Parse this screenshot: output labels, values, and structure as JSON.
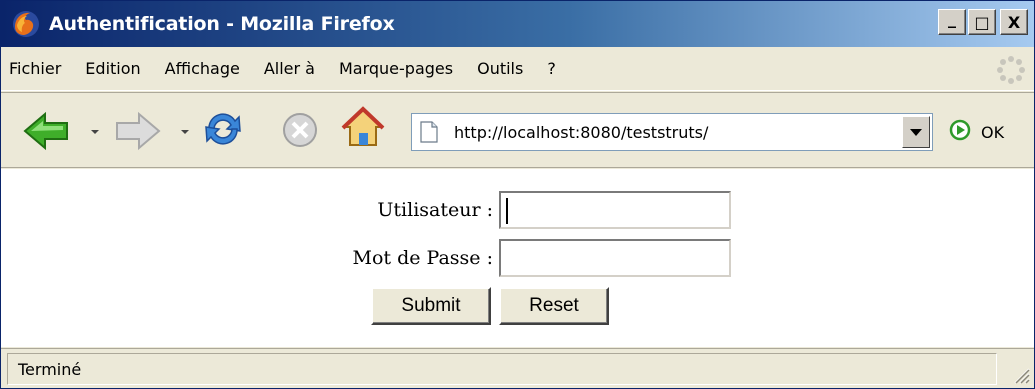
{
  "window": {
    "title": "Authentification - Mozilla Firefox",
    "minimize": "_",
    "maximize": "□",
    "close": "X"
  },
  "menu": {
    "items": [
      "Fichier",
      "Edition",
      "Affichage",
      "Aller à",
      "Marque-pages",
      "Outils",
      "?"
    ]
  },
  "toolbar": {
    "url": "http://localhost:8080/teststruts/",
    "go_label": "OK",
    "icons": [
      "back-icon",
      "forward-icon",
      "reload-icon",
      "stop-icon",
      "home-icon"
    ]
  },
  "form": {
    "user_label": "Utilisateur :",
    "user_value": "",
    "password_label": "Mot de Passe :",
    "password_value": "",
    "submit_label": "Submit",
    "reset_label": "Reset"
  },
  "status": {
    "text": "Terminé"
  },
  "colors": {
    "title_start": "#0a246a",
    "title_end": "#a6caf0",
    "chrome": "#ece9d8"
  }
}
